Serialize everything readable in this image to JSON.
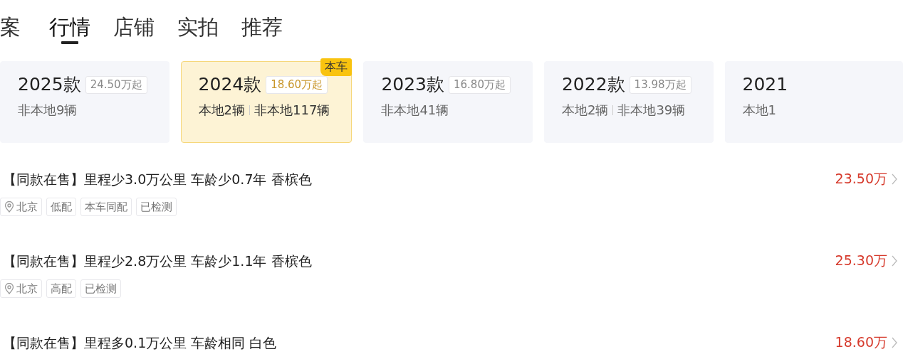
{
  "tabs": [
    {
      "label": "案",
      "selected": false
    },
    {
      "label": "行情",
      "selected": true
    },
    {
      "label": "店铺",
      "selected": false
    },
    {
      "label": "实拍",
      "selected": false
    },
    {
      "label": "推荐",
      "selected": false
    }
  ],
  "model_years": [
    {
      "year": "2025款",
      "price": "24.50万起",
      "counts": [
        "非本地9辆"
      ],
      "selected": false
    },
    {
      "year": "2024款",
      "price": "18.60万起",
      "counts": [
        "本地2辆",
        "非本地117辆"
      ],
      "selected": true,
      "badge": "本车"
    },
    {
      "year": "2023款",
      "price": "16.80万起",
      "counts": [
        "非本地41辆"
      ],
      "selected": false
    },
    {
      "year": "2022款",
      "price": "13.98万起",
      "counts": [
        "本地2辆",
        "非本地39辆"
      ],
      "selected": false
    },
    {
      "year": "2021",
      "counts": [
        "本地1"
      ],
      "selected": false
    }
  ],
  "listings": [
    {
      "title": "【同款在售】里程少3.0万公里 车龄少0.7年 香槟色",
      "price": "23.50万",
      "tags": [
        {
          "kind": "location",
          "label": "北京"
        },
        {
          "kind": "plain",
          "label": "低配"
        },
        {
          "kind": "plain",
          "label": "本车同配"
        },
        {
          "kind": "plain",
          "label": "已检测"
        }
      ]
    },
    {
      "title": "【同款在售】里程少2.8万公里 车龄少1.1年 香槟色",
      "price": "25.30万",
      "tags": [
        {
          "kind": "location",
          "label": "北京"
        },
        {
          "kind": "plain",
          "label": "高配"
        },
        {
          "kind": "plain",
          "label": "已检测"
        }
      ]
    },
    {
      "title": "【同款在售】里程多0.1万公里 车龄相同 白色",
      "price": "18.60万"
    }
  ]
}
